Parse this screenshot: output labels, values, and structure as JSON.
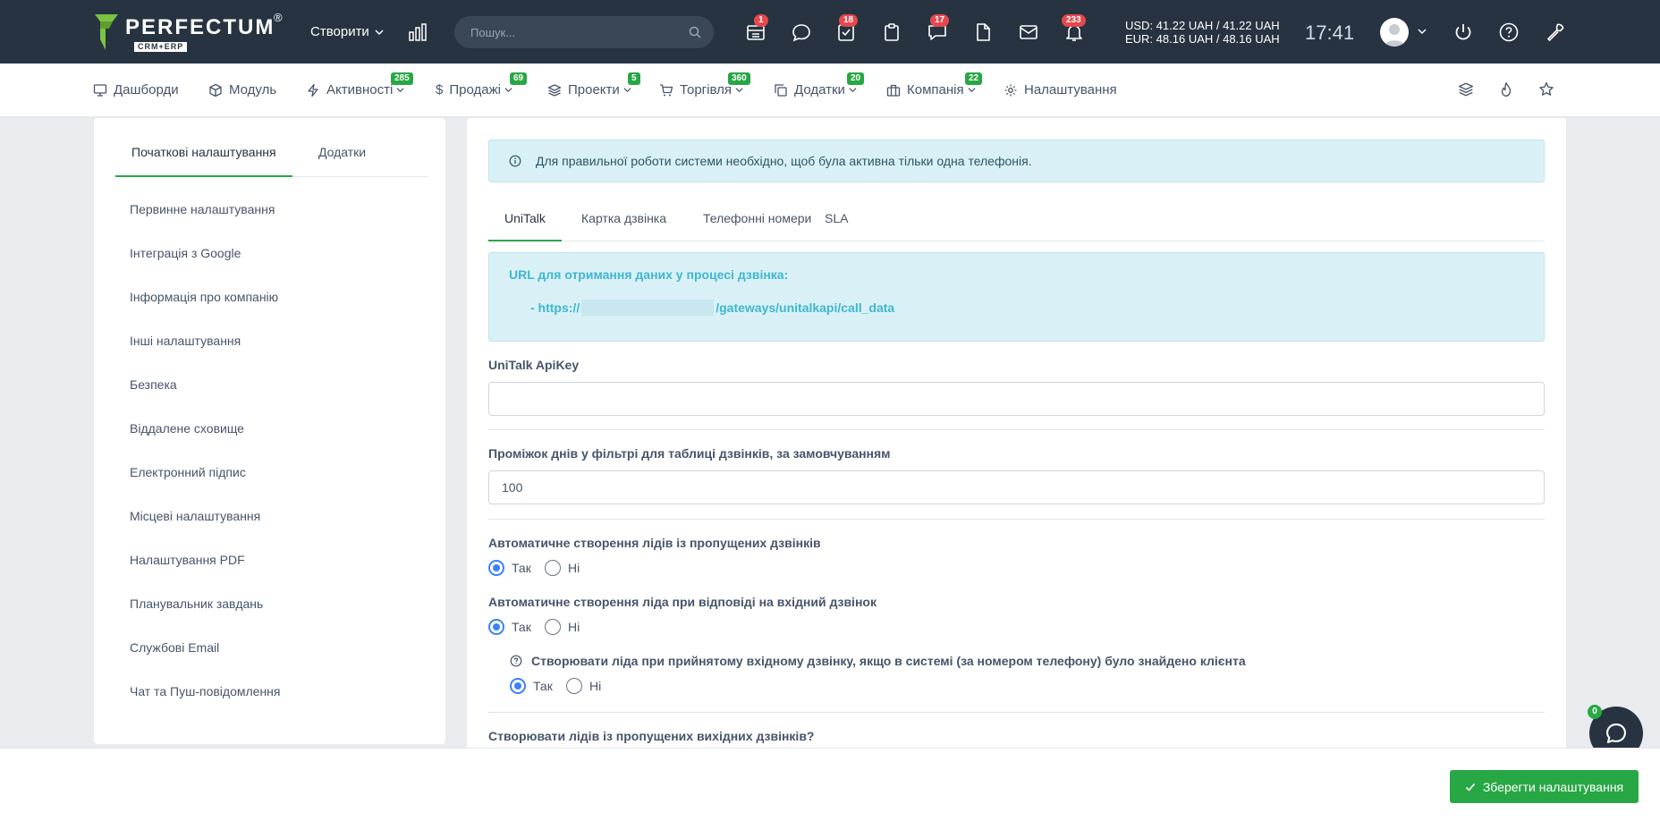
{
  "header": {
    "logo_text": "PERFECTUM",
    "logo_sub": "CRM+ERP",
    "logo_reg": "®",
    "create_label": "Створити",
    "search_placeholder": "Пошук...",
    "badges": {
      "calendar": "1",
      "tasks": "18",
      "chat": "17",
      "notifications": "233"
    },
    "currency_usd": "USD: 41.22 UAH / 41.22 UAH",
    "currency_eur": "EUR: 48.16 UAH / 48.16 UAH",
    "clock": "17:41"
  },
  "nav": {
    "items": [
      {
        "label": "Дашборди",
        "badge": ""
      },
      {
        "label": "Модуль",
        "badge": ""
      },
      {
        "label": "Активності",
        "badge": "285"
      },
      {
        "label": "Продажі",
        "badge": "69"
      },
      {
        "label": "Проекти",
        "badge": "5"
      },
      {
        "label": "Торгівля",
        "badge": "360"
      },
      {
        "label": "Додатки",
        "badge": "20"
      },
      {
        "label": "Компанія",
        "badge": "22"
      },
      {
        "label": "Налаштування",
        "badge": ""
      }
    ]
  },
  "sidebar": {
    "tabs": [
      "Початкові налаштування",
      "Додатки"
    ],
    "items": [
      "Первинне налаштування",
      "Інтеграція з Google",
      "Інформація про компанію",
      "Інші налаштування",
      "Безпека",
      "Віддалене сховище",
      "Електронний підпис",
      "Місцеві налаштування",
      "Налаштування PDF",
      "Планувальник завдань",
      "Службові Email",
      "Чат та Пуш-повідомлення"
    ]
  },
  "main": {
    "alert": "Для правильної роботи системи необхідно, щоб була активна тільки одна телефонія.",
    "tabs": [
      "UniTalk",
      "Картка дзвінка",
      "Телефонні номери",
      "SLA"
    ],
    "url_title": "URL для отримання даних у процесі дзвінка:",
    "url_prefix": "- https://",
    "url_suffix": "/gateways/unitalkapi/call_data",
    "apikey_label": "UniTalk ApiKey",
    "apikey_value": "",
    "days_label": "Проміжок днів у фільтрі для таблиці дзвінків, за замовчуванням",
    "days_value": "100",
    "auto_missed_label": "Автоматичне створення лідів із пропущених дзвінків",
    "auto_answer_label": "Автоматичне створення ліда при відповіді на вхідний дзвінок",
    "sub_label": "Створювати ліда при прийнятому вхідному дзвінку, якщо в системі (за номером телефону) було знайдено клієнта",
    "outgoing_label": "Створювати лідів із пропущених вихідних дзвінків?",
    "yes": "Так",
    "no": "Ні"
  },
  "footer": {
    "save_label": "Зберегти налаштування",
    "chat_badge": "0"
  },
  "colors": {
    "accent": "#28a745",
    "header_bg": "#273340",
    "info_bg": "#d9f1f6",
    "badge_red": "#e5484d"
  }
}
